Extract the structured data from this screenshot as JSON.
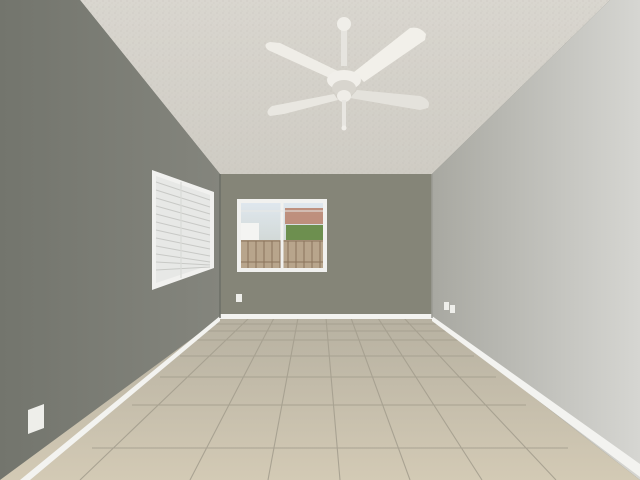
{
  "scene": {
    "description_label": "empty room",
    "watermark": "",
    "colors": {
      "ceiling": "#e0ddd6",
      "back_wall": "#858578",
      "left_wall": "#7a7b73",
      "right_wall": "#c7c7c2",
      "floor": "#cfc6b2",
      "baseboard": "#f3f3f0",
      "window_frame": "#f1f1ef",
      "fan": "#efede7"
    },
    "icons": [
      "ceiling-fan-icon",
      "window-icon",
      "outlet-icon"
    ]
  }
}
